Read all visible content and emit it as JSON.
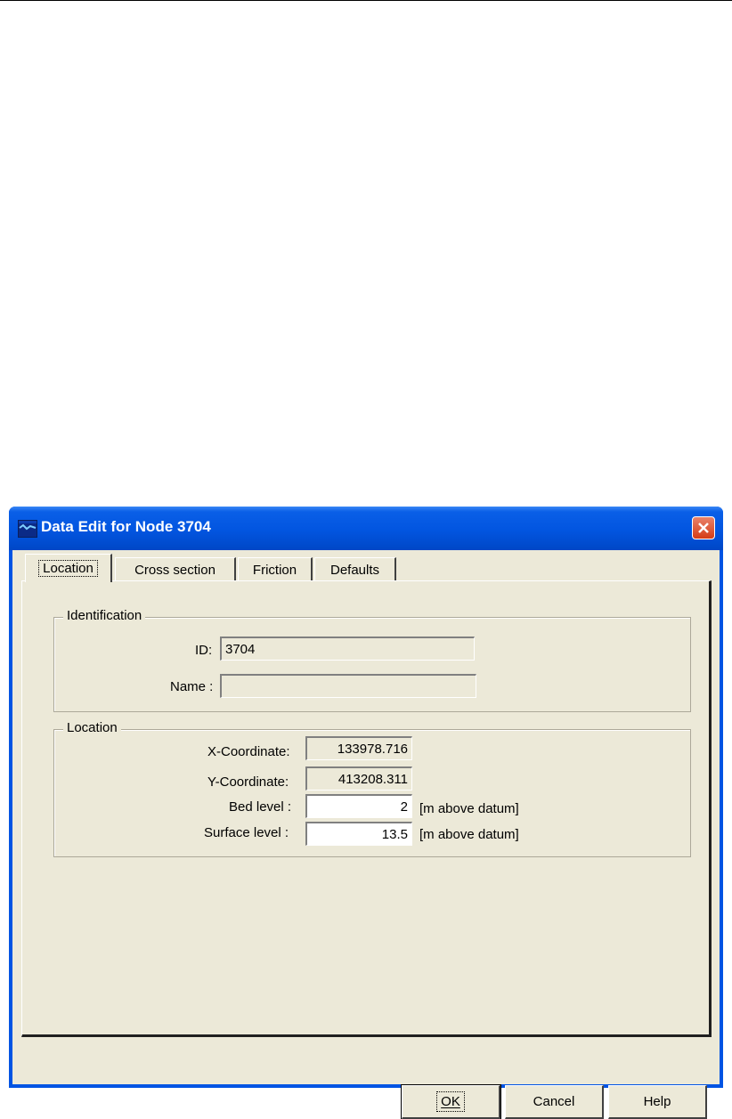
{
  "window": {
    "title": "Data Edit for Node 3704"
  },
  "tabs": [
    {
      "label": "Location",
      "active": true
    },
    {
      "label": "Cross section",
      "active": false
    },
    {
      "label": "Friction",
      "active": false
    },
    {
      "label": "Defaults",
      "active": false
    }
  ],
  "identification": {
    "group_label": "Identification",
    "id_label": "ID:",
    "id_value": "3704",
    "name_label": "Name :",
    "name_value": ""
  },
  "location": {
    "group_label": "Location",
    "x_label": "X-Coordinate:",
    "x_value": "133978.716",
    "y_label": "Y-Coordinate:",
    "y_value": "413208.311",
    "bed_label": "Bed level :",
    "bed_value": "2",
    "bed_unit": "[m above datum]",
    "surface_label": "Surface level :",
    "surface_value": "13.5",
    "surface_unit": "[m above datum]"
  },
  "buttons": {
    "ok": "OK",
    "cancel": "Cancel",
    "help": "Help"
  },
  "icons": {
    "app": "river-icon",
    "close": "close-icon"
  },
  "colors": {
    "titlebar": "#0255e0",
    "close": "#d43c16",
    "dialog_bg": "#ece9d8"
  }
}
